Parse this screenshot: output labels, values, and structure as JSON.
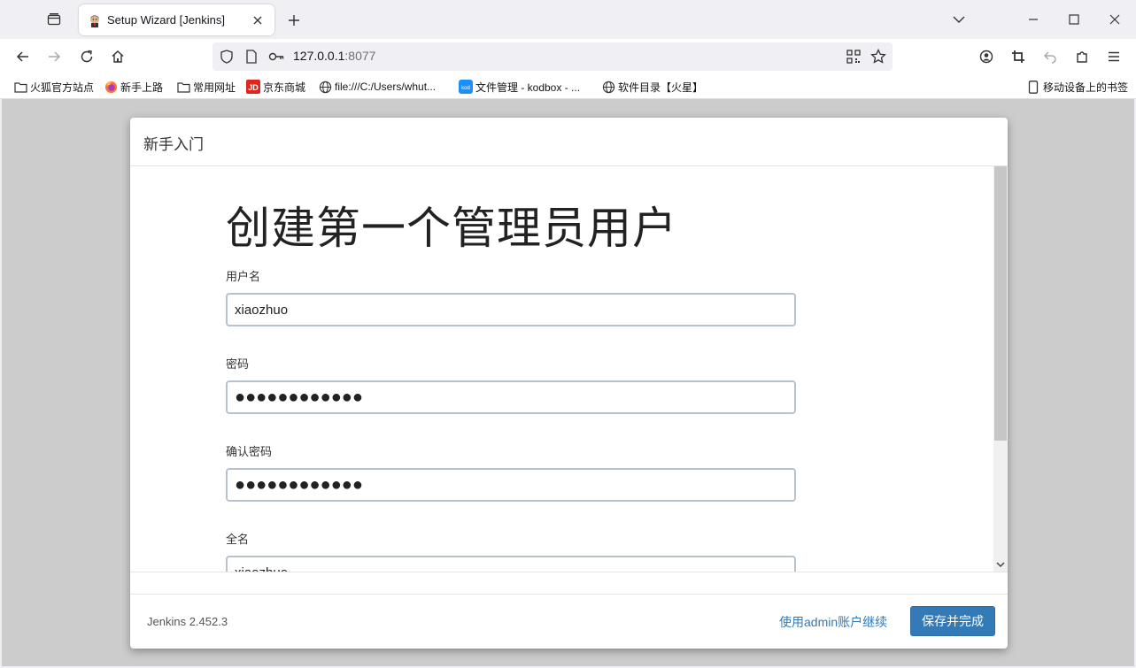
{
  "browser": {
    "tab": {
      "title": "Setup Wizard [Jenkins]"
    },
    "url": {
      "host": "127.0.0.1",
      "port": ":8077"
    },
    "bookmarks": [
      {
        "label": "火狐官方站点",
        "icon": "folder-icon"
      },
      {
        "label": "新手上路",
        "icon": "firefox-icon"
      },
      {
        "label": "常用网址",
        "icon": "folder-icon"
      },
      {
        "label": "京东商城",
        "icon": "jd-icon"
      },
      {
        "label": "file:///C:/Users/whut...",
        "icon": "globe-icon"
      },
      {
        "label": "文件管理 - kodbox - ...",
        "icon": "kodbox-icon"
      },
      {
        "label": "软件目录【火星】",
        "icon": "globe-icon"
      }
    ],
    "mobile_bookmarks": "移动设备上的书签"
  },
  "dialog": {
    "header_title": "新手入门",
    "heading": "创建第一个管理员用户",
    "fields": {
      "username": {
        "label": "用户名",
        "value": "xiaozhuo"
      },
      "password": {
        "label": "密码",
        "value": "●●●●●●●●●●●●"
      },
      "confirm_password": {
        "label": "确认密码",
        "value": "●●●●●●●●●●●●"
      },
      "fullname": {
        "label": "全名",
        "value": "xiaozhuo"
      }
    },
    "footer": {
      "version": "Jenkins 2.452.3",
      "continue_as_admin": "使用admin账户继续",
      "save_and_finish": "保存并完成"
    }
  },
  "colors": {
    "primary": "#337ab7",
    "overlay": "#cccccc"
  }
}
